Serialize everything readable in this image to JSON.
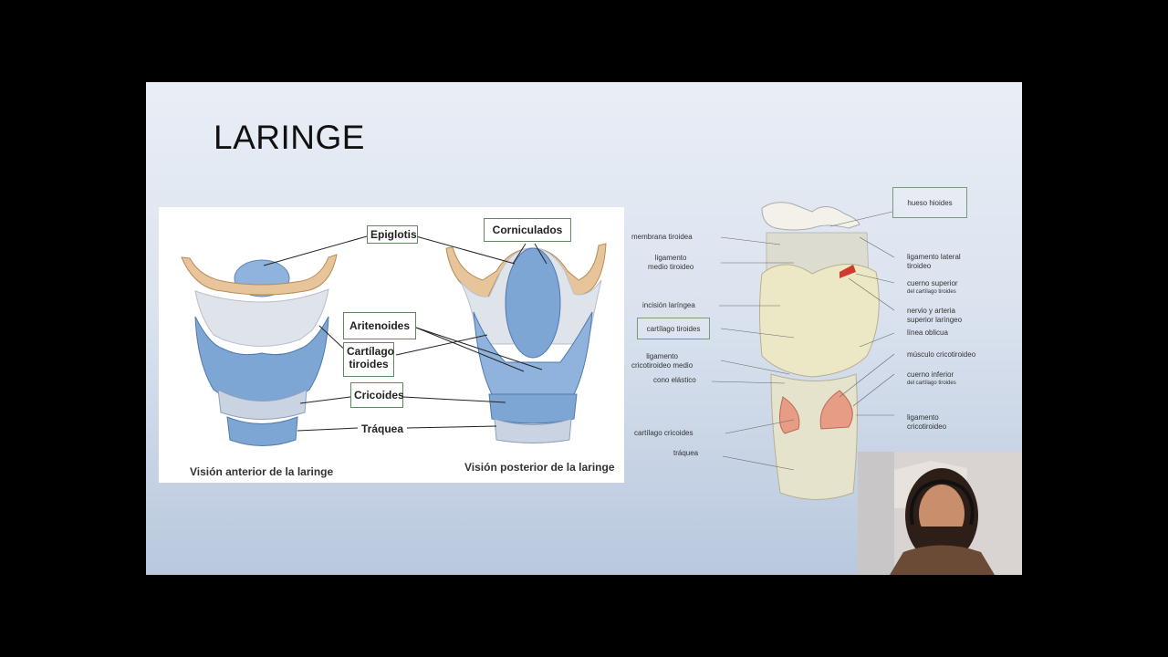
{
  "slide": {
    "title": "LARINGE"
  },
  "left_figure": {
    "labels": {
      "epiglotis": "Epiglotis",
      "corniculados": "Corniculados",
      "aritenoides": "Aritenoides",
      "cartilago": "Cartílago",
      "tiroides": "tiroides",
      "cricoides": "Cricoides",
      "traquea": "Tráquea"
    },
    "captions": {
      "anterior": "Visión anterior de la laringe",
      "posterior": "Visión posterior de la laringe"
    }
  },
  "right_figure": {
    "labels": {
      "hueso_hioides": "hueso hioides",
      "membrana_tiroidea": "membrana tiroidea",
      "ligamento_medio_1": "ligamento",
      "ligamento_medio_2": "medio tiroideo",
      "incision_laringea": "incisión laríngea",
      "cartilago_tiroides": "cartílago tiroides",
      "ligamento_crico_1": "ligamento",
      "ligamento_crico_2": "cricotiroideo medio",
      "cono_elastico": "cono elástico",
      "cartilago_cricoides": "cartílago cricoides",
      "traquea": "tráquea",
      "lig_lateral_1": "ligamento lateral",
      "lig_lateral_2": "tiroideo",
      "cuerno_sup_1": "cuerno superior",
      "cuerno_sup_2": "del cartílago tiroides",
      "nervio_1": "nervio y arteria",
      "nervio_2": "superior laríngeo",
      "linea_oblicua": "línea oblicua",
      "musculo": "músculo cricotiroideo",
      "cuerno_inf_1": "cuerno inferior",
      "cuerno_inf_2": "del cartílago tiroides",
      "lig_cricotiroideo_1": "ligamento",
      "lig_cricotiroideo_2": "cricotiroideo"
    }
  },
  "colors": {
    "background": "#000000",
    "slide_top": "#e9eef6",
    "slide_bottom": "#b9c8de",
    "cartilage_blue": "#7ea6d4",
    "hyoid_tan": "#e8c49a",
    "cartilage_cream": "#ece8c6"
  }
}
